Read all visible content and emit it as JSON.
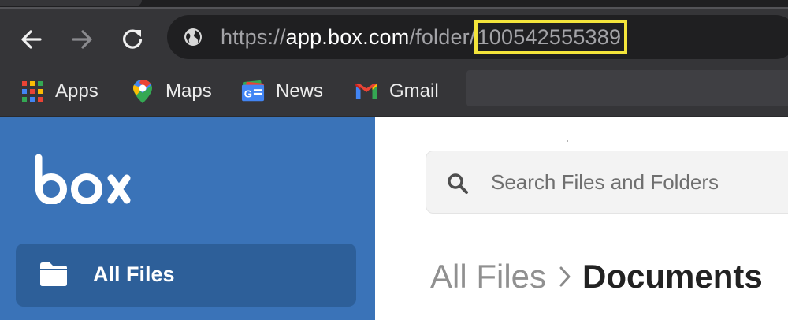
{
  "browser": {
    "url": {
      "scheme": "https://",
      "host": "app.box.com",
      "path": "/folder/",
      "folder_id": "100542555389"
    },
    "highlight_color": "#f3e43b",
    "bookmarks": [
      {
        "label": "Apps",
        "icon": "apps-grid-icon"
      },
      {
        "label": "Maps",
        "icon": "google-maps-icon"
      },
      {
        "label": "News",
        "icon": "google-news-icon"
      },
      {
        "label": "Gmail",
        "icon": "gmail-icon"
      }
    ]
  },
  "box": {
    "brand_color": "#3a73b8",
    "logo_text": "box",
    "sidebar": {
      "items": [
        {
          "label": "All Files",
          "icon": "folder-icon",
          "active": true
        }
      ]
    },
    "search": {
      "placeholder": "Search Files and Folders"
    },
    "breadcrumb": {
      "root": "All Files",
      "current": "Documents"
    }
  }
}
